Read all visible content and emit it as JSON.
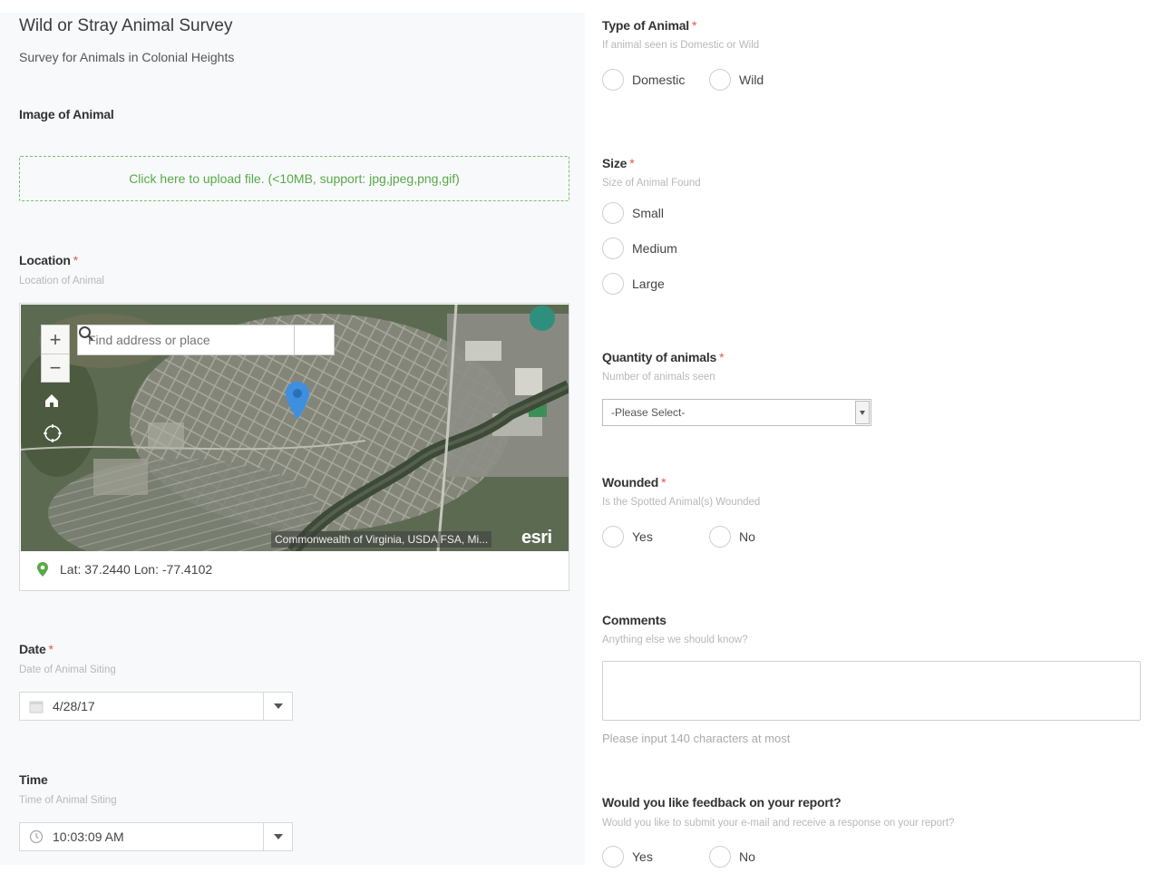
{
  "survey": {
    "title": "Wild or Stray Animal Survey",
    "subtitle": "Survey for Animals in Colonial Heights"
  },
  "image_field": {
    "label": "Image of Animal",
    "upload_text": "Click here to upload file. (<10MB, support: jpg,jpeg,png,gif)"
  },
  "location_field": {
    "label": "Location",
    "required": "*",
    "hint": "Location of Animal",
    "search_placeholder": "Find address or place",
    "zoom_in": "+",
    "zoom_out": "−",
    "attribution": "Commonwealth of Virginia, USDA FSA, Mi...",
    "logo": "esri",
    "coords": "Lat: 37.2440 Lon: -77.4102"
  },
  "date_field": {
    "label": "Date",
    "required": "*",
    "hint": "Date of Animal Siting",
    "value": "4/28/17"
  },
  "time_field": {
    "label": "Time",
    "hint": "Time of Animal Siting",
    "value": "10:03:09 AM"
  },
  "type_field": {
    "label": "Type of Animal",
    "required": "*",
    "hint": "If animal seen is Domestic or Wild",
    "options": [
      "Domestic",
      "Wild"
    ]
  },
  "size_field": {
    "label": "Size",
    "required": "*",
    "hint": "Size of Animal Found",
    "options": [
      "Small",
      "Medium",
      "Large"
    ]
  },
  "quantity_field": {
    "label": "Quantity of animals",
    "required": "*",
    "hint": "Number of animals seen",
    "value": "-Please Select-"
  },
  "wounded_field": {
    "label": "Wounded",
    "required": "*",
    "hint": "Is the Spotted Animal(s) Wounded",
    "options": [
      "Yes",
      "No"
    ]
  },
  "comments_field": {
    "label": "Comments",
    "hint": "Anything else we should know?",
    "counter": "Please input 140 characters at most"
  },
  "feedback_field": {
    "label": "Would you like feedback on your report?",
    "hint": "Would you like to submit your e-mail and receive a response on your report?",
    "options": [
      "Yes",
      "No"
    ]
  },
  "colors": {
    "required": "#e0584b",
    "upload_border": "#7bbf6a",
    "upload_text": "#5aa848",
    "map_pin": "#3f8fe0"
  },
  "icons": [
    "home-icon",
    "locate-icon",
    "search-icon",
    "location-pin-icon",
    "calendar-icon",
    "clock-icon",
    "map-marker-icon"
  ]
}
